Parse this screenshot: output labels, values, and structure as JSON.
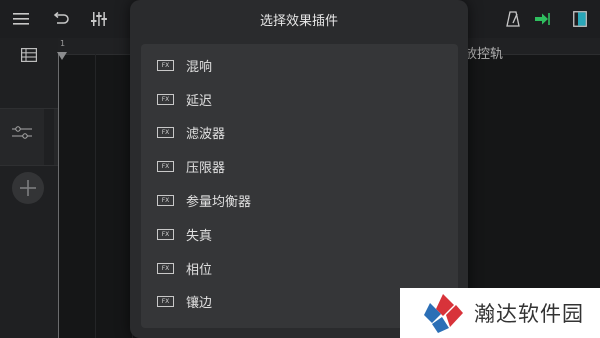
{
  "dialog": {
    "title": "选择效果插件",
    "items": [
      {
        "badge": "FX",
        "label": "混响"
      },
      {
        "badge": "FX",
        "label": "延迟"
      },
      {
        "badge": "FX",
        "label": "滤波器"
      },
      {
        "badge": "FX",
        "label": "压限器"
      },
      {
        "badge": "FX",
        "label": "参量均衡器"
      },
      {
        "badge": "FX",
        "label": "失真"
      },
      {
        "badge": "FX",
        "label": "相位"
      },
      {
        "badge": "FX",
        "label": "镶边"
      }
    ]
  },
  "background": {
    "track_hint": "放控轨",
    "ruler_start": "1"
  },
  "toolbar_icons": [
    "menu-icon",
    "undo-icon",
    "mixer-sliders-icon",
    "metronome-icon",
    "export-arrow-icon",
    "panel-toggle-icon"
  ],
  "colors": {
    "accent_green": "#2fbf5f",
    "accent_teal": "#2aa7b8"
  },
  "watermark": {
    "text": "瀚达软件园"
  }
}
